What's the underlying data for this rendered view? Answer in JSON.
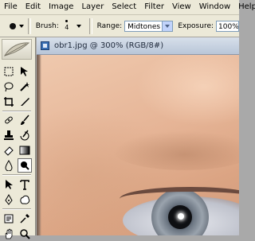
{
  "menubar": {
    "items": [
      "File",
      "Edit",
      "Image",
      "Layer",
      "Select",
      "Filter",
      "View",
      "Window",
      "Help"
    ]
  },
  "options_bar": {
    "tool_preset_icon": "burn-tool-icon",
    "brush_label": "Brush:",
    "brush_size": "4",
    "range_label": "Range:",
    "range_value": "Midtones",
    "exposure_label": "Exposure:",
    "exposure_value": "100%"
  },
  "toolbox": {
    "tools": [
      "marquee-icon",
      "move-icon",
      "lasso-icon",
      "magic-wand-icon",
      "crop-icon",
      "slice-icon",
      "healing-brush-icon",
      "brush-icon",
      "clone-stamp-icon",
      "history-brush-icon",
      "eraser-icon",
      "gradient-icon",
      "blur-icon",
      "burn-icon",
      "path-selection-icon",
      "type-icon",
      "pen-icon",
      "shape-icon",
      "notes-icon",
      "eyedropper-icon",
      "hand-icon",
      "zoom-icon"
    ],
    "active_tool": "burn-icon"
  },
  "document": {
    "title": "obr1.jpg @ 300% (RGB/8#)"
  }
}
